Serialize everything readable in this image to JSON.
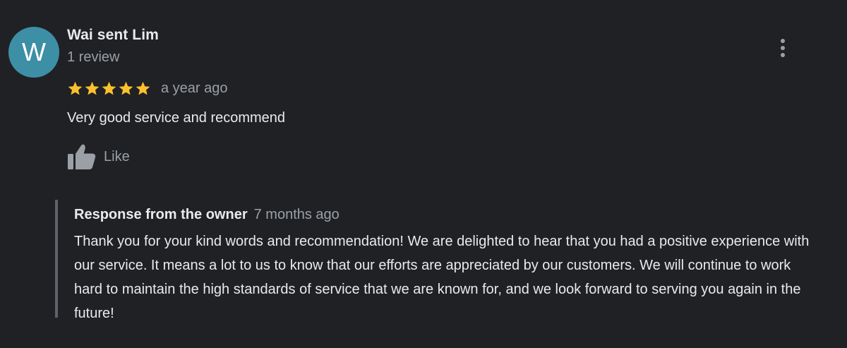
{
  "reviewer": {
    "initial": "W",
    "name": "Wai sent Lim",
    "review_count": "1 review",
    "avatar_color": "#3d8fa6"
  },
  "review": {
    "rating": 5,
    "rating_max": 5,
    "star_color": "#fbc02d",
    "time": "a year ago",
    "text": "Very good service and recommend"
  },
  "actions": {
    "like_label": "Like",
    "like_icon": "thumbs-up-icon",
    "more_icon": "more-vert-icon"
  },
  "owner_response": {
    "title": "Response from the owner",
    "time": "7 months ago",
    "text": "Thank you for your kind words and recommendation! We are delighted to hear that you had a positive experience with our service. It means a lot to us to know that our efforts are appreciated by our customers. We will continue to work hard to maintain the high standards of service that we are known for, and we look forward to serving you again in the future!"
  }
}
